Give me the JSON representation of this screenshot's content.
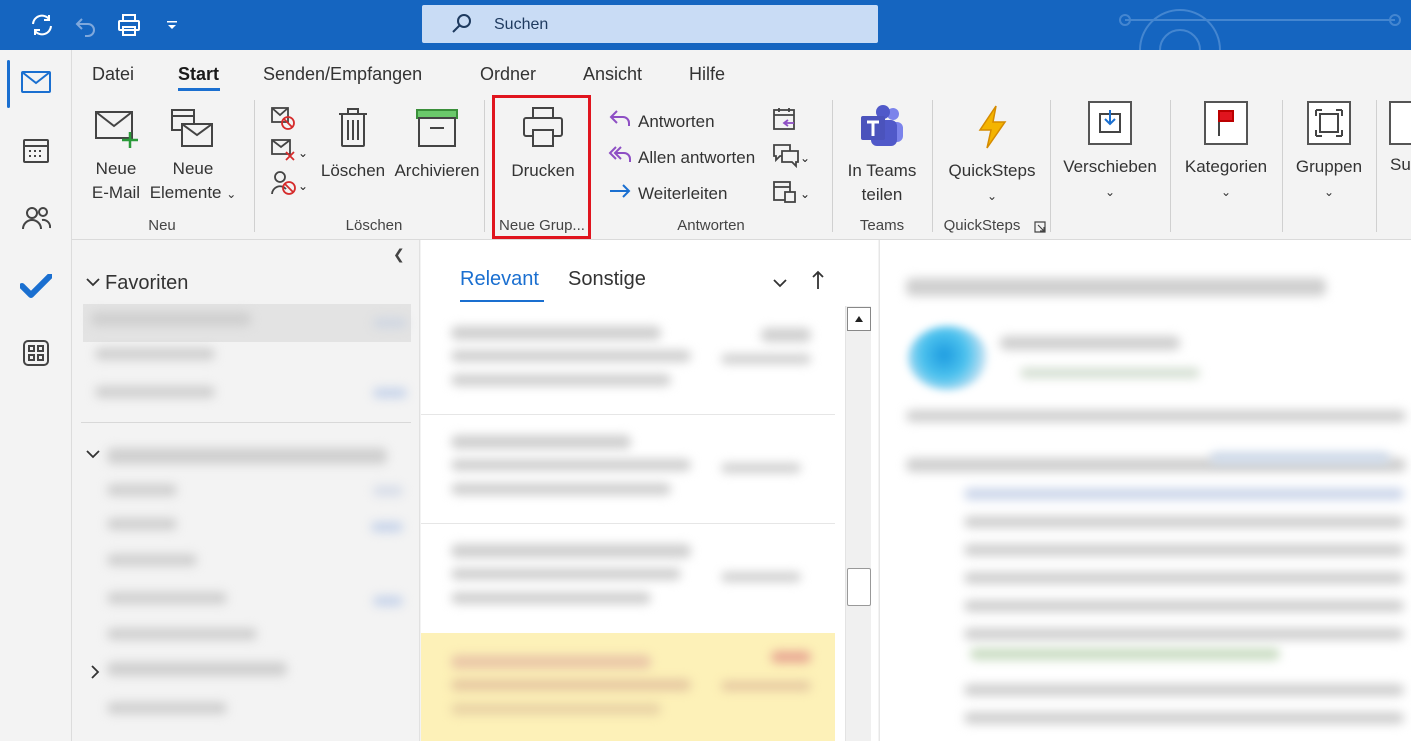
{
  "titlebar": {
    "search_placeholder": "Suchen",
    "icons": [
      "sync-icon",
      "undo-icon",
      "print-icon",
      "customize-toolbar-icon",
      "search-icon"
    ]
  },
  "nav_rail": {
    "items": [
      {
        "name": "mail-icon",
        "active": true
      },
      {
        "name": "calendar-icon",
        "active": false
      },
      {
        "name": "people-icon",
        "active": false
      },
      {
        "name": "todo-icon",
        "active": false
      },
      {
        "name": "apps-icon",
        "active": false
      }
    ]
  },
  "menu": {
    "tabs": [
      "Datei",
      "Start",
      "Senden/Empfangen",
      "Ordner",
      "Ansicht",
      "Hilfe"
    ],
    "active": "Start"
  },
  "ribbon": {
    "neu": {
      "group_label": "Neu",
      "new_email_l1": "Neue",
      "new_email_l2": "E-Mail",
      "new_items_l1": "Neue",
      "new_items_l2": "Elemente"
    },
    "loeschen": {
      "group_label": "Löschen",
      "delete_label": "Löschen",
      "archive_label": "Archivieren"
    },
    "neue_gruppe": {
      "group_label": "Neue Grup...",
      "print_label": "Drucken"
    },
    "antworten": {
      "group_label": "Antworten",
      "reply_label": "Antworten",
      "reply_all_label": "Allen antworten",
      "forward_label": "Weiterleiten"
    },
    "teams": {
      "group_label": "Teams",
      "share_l1": "In Teams",
      "share_l2": "teilen"
    },
    "quicksteps": {
      "group_label": "QuickSteps",
      "button_label": "QuickSteps"
    },
    "move_label": "Verschieben",
    "categories_label": "Kategorien",
    "groups_label": "Gruppen",
    "more_label": "Su"
  },
  "folders": {
    "favorites_label": "Favoriten"
  },
  "message_list": {
    "tab_relevant": "Relevant",
    "tab_other": "Sonstige"
  },
  "colors": {
    "titlebar": "#1565c0",
    "accent": "#1a6fd0",
    "highlight_box": "#e0141e",
    "selected_row": "#fdf1b8"
  }
}
